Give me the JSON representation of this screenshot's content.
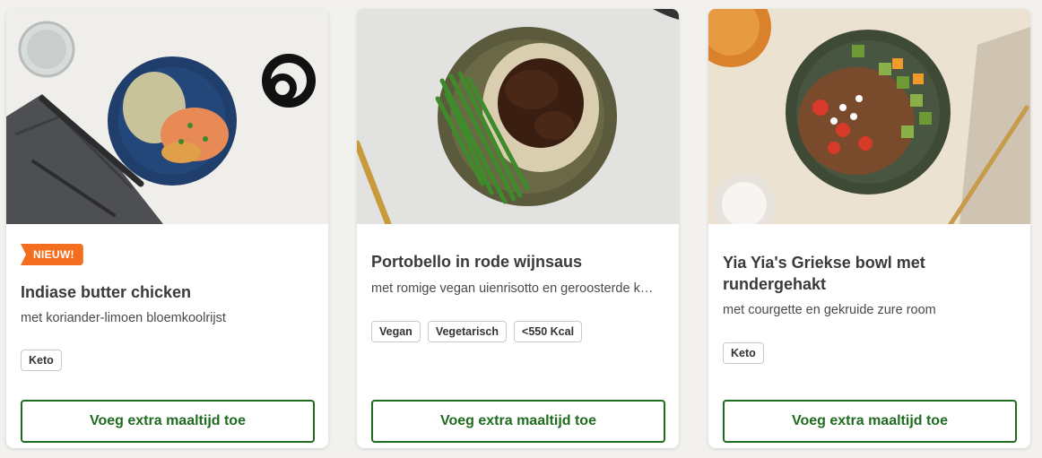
{
  "cards": [
    {
      "badge": "NIEUW!",
      "title": "Indiase butter chicken",
      "subtitle": "met koriander-limoen bloemkoolrijst",
      "tags": [
        "Keto"
      ],
      "button_label": "Voeg extra maaltijd toe"
    },
    {
      "title": "Portobello in rode wijnsaus",
      "subtitle": "met romige vegan uienrisotto en geroosterde k…",
      "tags": [
        "Vegan",
        "Vegetarisch",
        "<550 Kcal"
      ],
      "button_label": "Voeg extra maaltijd toe"
    },
    {
      "title": "Yia Yia's Griekse bowl met rundergehakt",
      "subtitle": "met courgette en gekruide zure room",
      "tags": [
        "Keto"
      ],
      "button_label": "Voeg extra maaltijd toe"
    }
  ],
  "colors": {
    "accent_green": "#1f6b1f",
    "badge_orange": "#f36e1f",
    "page_background": "#f2f1ee"
  }
}
